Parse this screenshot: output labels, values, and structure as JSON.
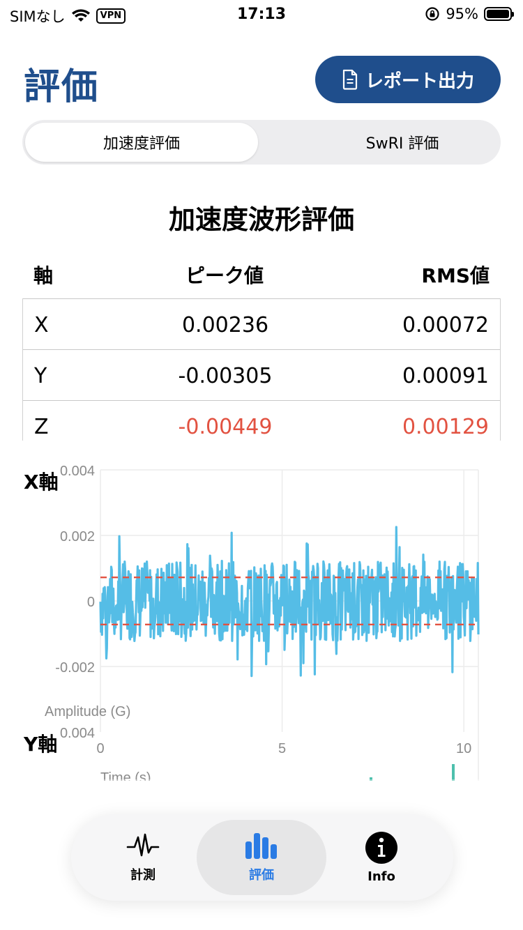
{
  "status_bar": {
    "carrier": "SIMなし",
    "vpn": "VPN",
    "time": "17:13",
    "battery": "95%"
  },
  "header": {
    "title": "評価",
    "report_button": "レポート出力"
  },
  "segments": [
    "加速度評価",
    "SwRI 評価"
  ],
  "section_title": "加速度波形評価",
  "table": {
    "headers": [
      "軸",
      "ピーク値",
      "RMS値"
    ],
    "rows": [
      {
        "axis": "X",
        "peak": "0.00236",
        "rms": "0.00072"
      },
      {
        "axis": "Y",
        "peak": "-0.00305",
        "rms": "0.00091"
      },
      {
        "axis": "Z",
        "peak": "-0.00449",
        "rms": "0.00129"
      }
    ]
  },
  "chart_data": {
    "type": "line",
    "title": "X軸",
    "xlabel": "Time (s)",
    "ylabel": "Amplitude (G)",
    "xlim": [
      0,
      10.4
    ],
    "ylim": [
      -0.004,
      0.004
    ],
    "x_ticks": [
      "0",
      "5",
      "10"
    ],
    "y_ticks": [
      "0.004",
      "0.002",
      "0",
      "-0.002"
    ],
    "grid": true,
    "series": [
      {
        "type": "noise",
        "peak": 0.00236,
        "rms": 0.00072,
        "color": "#55bde6"
      }
    ],
    "reference_lines": [
      0.00072,
      -0.00072
    ],
    "reference_color": "#e25241",
    "next_chart_title": "Y軸",
    "next_chart_top_tick": "0.004"
  },
  "tabs": [
    {
      "label": "計測",
      "icon": "pulse-icon"
    },
    {
      "label": "評価",
      "icon": "bar-chart-icon"
    },
    {
      "label": "Info",
      "icon": "info-icon"
    }
  ],
  "colors": {
    "accent": "#1f4e8c",
    "tab_active": "#2a7be4",
    "warning": "#e25241",
    "line": "#55bde6"
  }
}
